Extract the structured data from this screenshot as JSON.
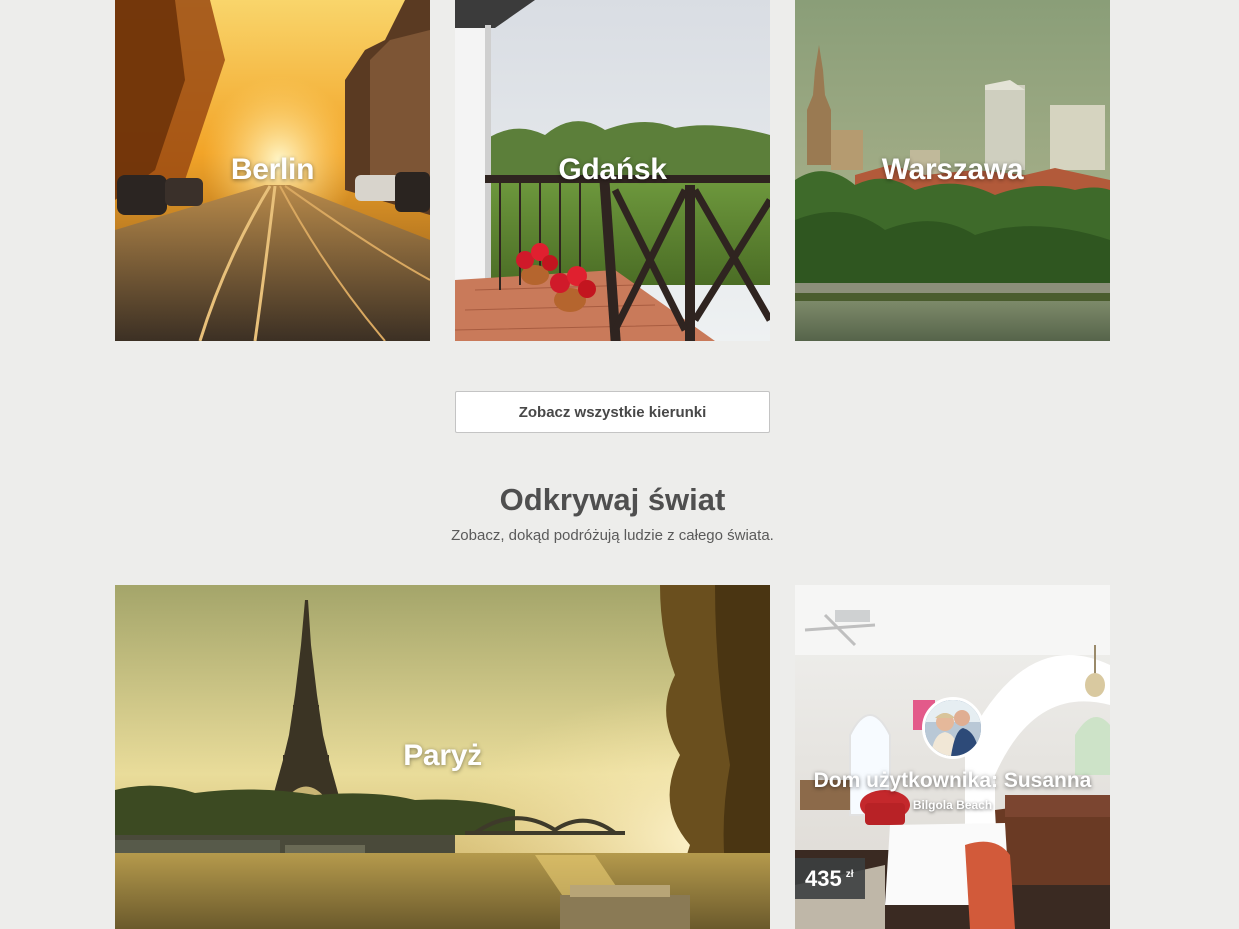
{
  "destinations": [
    {
      "name": "Berlin"
    },
    {
      "name": "Gdańsk"
    },
    {
      "name": "Warszawa"
    }
  ],
  "see_all_button": {
    "label": "Zobacz wszystkie kierunki"
  },
  "discover": {
    "title": "Odkrywaj świat",
    "subtitle": "Zobacz, dokąd podróżują ludzie z całego świata."
  },
  "featured_city": {
    "name": "Paryż"
  },
  "listing": {
    "title": "Dom użytkownika: Susanna",
    "location": "Bilgola Beach",
    "price": "435",
    "currency": "zł"
  }
}
